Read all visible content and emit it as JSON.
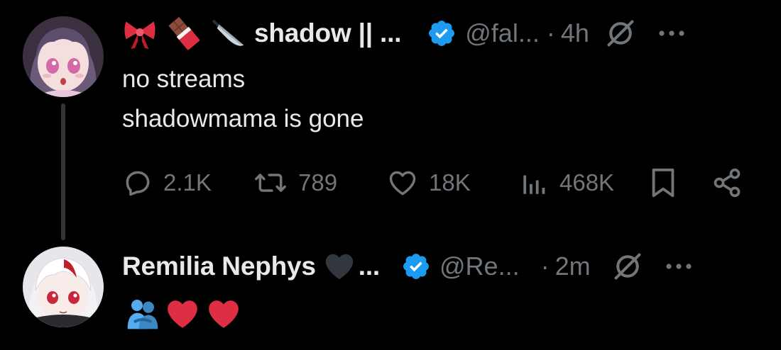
{
  "colors": {
    "background": "#000000",
    "text_primary": "#e7e9ea",
    "text_secondary": "#71767b",
    "verified_blue": "#1d9bf0",
    "heart_red": "#dd2e44"
  },
  "tweets": [
    {
      "avatar_icon": "anime-girl-avatar-purple",
      "name_emojis": [
        "ribbon-emoji",
        "chocolate-bar-emoji",
        "kitchen-knife-emoji"
      ],
      "display_name": "shadow || ...",
      "verified": true,
      "handle": "@fal...",
      "separator": "·",
      "time": "4h",
      "body": "no streams\nshadowmama is gone",
      "actions": {
        "replies": "2.1K",
        "reposts": "789",
        "likes": "18K",
        "views": "468K"
      }
    },
    {
      "avatar_icon": "anime-girl-avatar-white-red",
      "display_name": "Remilia Nephys",
      "name_emojis": [
        "black-heart-emoji"
      ],
      "name_suffix": "...",
      "verified": true,
      "handle": "@Re...",
      "separator": "·",
      "time": "2m",
      "body_emojis": [
        "people-hugging-emoji",
        "red-heart-emoji",
        "red-heart-emoji"
      ]
    }
  ]
}
